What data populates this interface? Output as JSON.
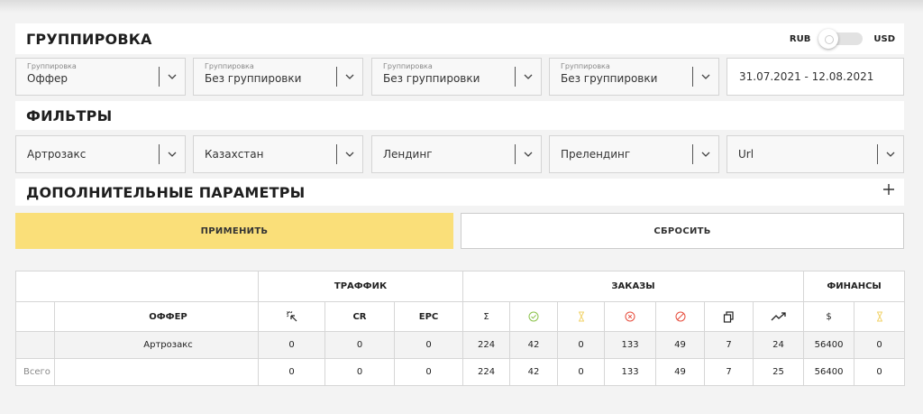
{
  "grouping": {
    "title": "ГРУППИРОВКА",
    "currency_left": "RUB",
    "currency_right": "USD",
    "selects": [
      {
        "caption": "Группировка",
        "value": "Оффер"
      },
      {
        "caption": "Группировка",
        "value": "Без группировки"
      },
      {
        "caption": "Группировка",
        "value": "Без группировки"
      },
      {
        "caption": "Группировка",
        "value": "Без группировки"
      }
    ],
    "date_range": "31.07.2021 - 12.08.2021"
  },
  "filters": {
    "title": "ФИЛЬТРЫ",
    "selects": [
      {
        "value": "Артрозакс"
      },
      {
        "value": "Казахстан"
      },
      {
        "value": "Лендинг"
      },
      {
        "value": "Прелендинг"
      },
      {
        "value": "Url"
      }
    ]
  },
  "extra": {
    "title": "ДОПОЛНИТЕЛЬНЫЕ ПАРАМЕТРЫ"
  },
  "buttons": {
    "apply": "ПРИМЕНИТЬ",
    "reset": "СБРОСИТЬ"
  },
  "table": {
    "groups": {
      "traffic": "ТРАФФИК",
      "orders": "ЗАКАЗЫ",
      "finance": "ФИНАНСЫ"
    },
    "headers": {
      "offer": "ОФФЕР",
      "cr": "CR",
      "epc": "EPC",
      "sum": "Σ",
      "dollar": "$"
    },
    "icons": [
      "click-icon",
      "check-circle-icon",
      "hourglass-icon",
      "x-circle-icon",
      "cancel-icon",
      "copy-icon",
      "trend-icon",
      "hourglass-icon"
    ],
    "colors": {
      "check": "#8bc34a",
      "pending": "#f2d36b",
      "reject": "#e74c3c"
    },
    "rows": [
      {
        "label": "",
        "offer": "Артрозакс",
        "values": [
          "0",
          "0",
          "0",
          "224",
          "42",
          "0",
          "133",
          "49",
          "7",
          "24",
          "56400",
          "0"
        ]
      },
      {
        "label": "Всего",
        "offer": "",
        "values": [
          "0",
          "0",
          "0",
          "224",
          "42",
          "0",
          "133",
          "49",
          "7",
          "25",
          "56400",
          "0"
        ]
      }
    ]
  }
}
